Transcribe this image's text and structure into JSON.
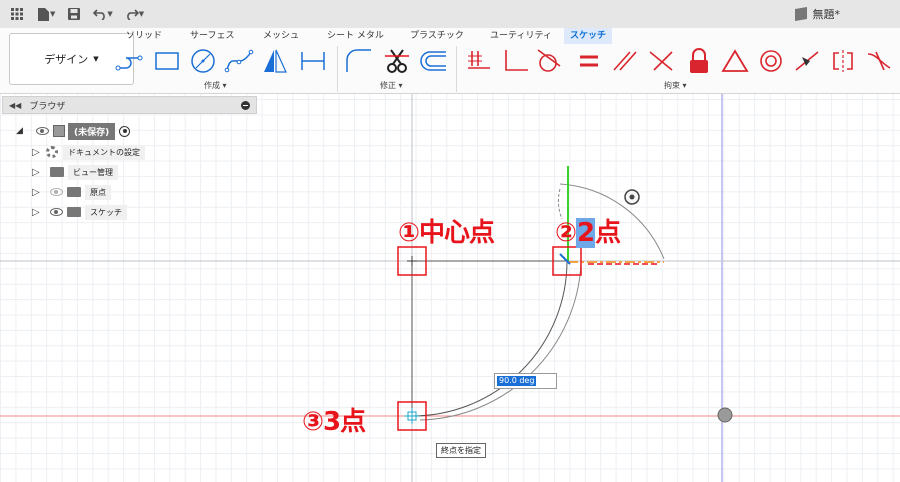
{
  "app": {
    "title": "無題*",
    "qa_icons": [
      "apps-grid-icon",
      "file-icon",
      "save-icon",
      "undo-icon",
      "redo-icon"
    ]
  },
  "ribbon": {
    "workspace": "デザイン",
    "tabs": [
      "ソリッド",
      "サーフェス",
      "メッシュ",
      "シート メタル",
      "プラスチック",
      "ユーティリティ",
      "スケッチ"
    ],
    "active_tab": "スケッチ",
    "groups": {
      "create": "作成",
      "modify": "修正",
      "constraints": "拘束"
    }
  },
  "browser": {
    "title": "ブラウザ",
    "root": "(未保存)",
    "items": [
      "ドキュメントの設定",
      "ビュー管理",
      "原点",
      "スケッチ"
    ]
  },
  "annotations": {
    "center": "①中心点",
    "point2_prefix": "②",
    "point2_num": "2",
    "point2_suffix": "点",
    "point3": "③3点"
  },
  "dimension_input": "90.0 deg",
  "tooltip": "終点を指定",
  "colors": {
    "accent": "#0b6fd6",
    "annotation_red": "#e8141c",
    "constraint_red": "#d9262e",
    "x_axis": "#ef8a8a",
    "y_axis": "#8b8fe0",
    "green_axis": "#3bd22b"
  }
}
